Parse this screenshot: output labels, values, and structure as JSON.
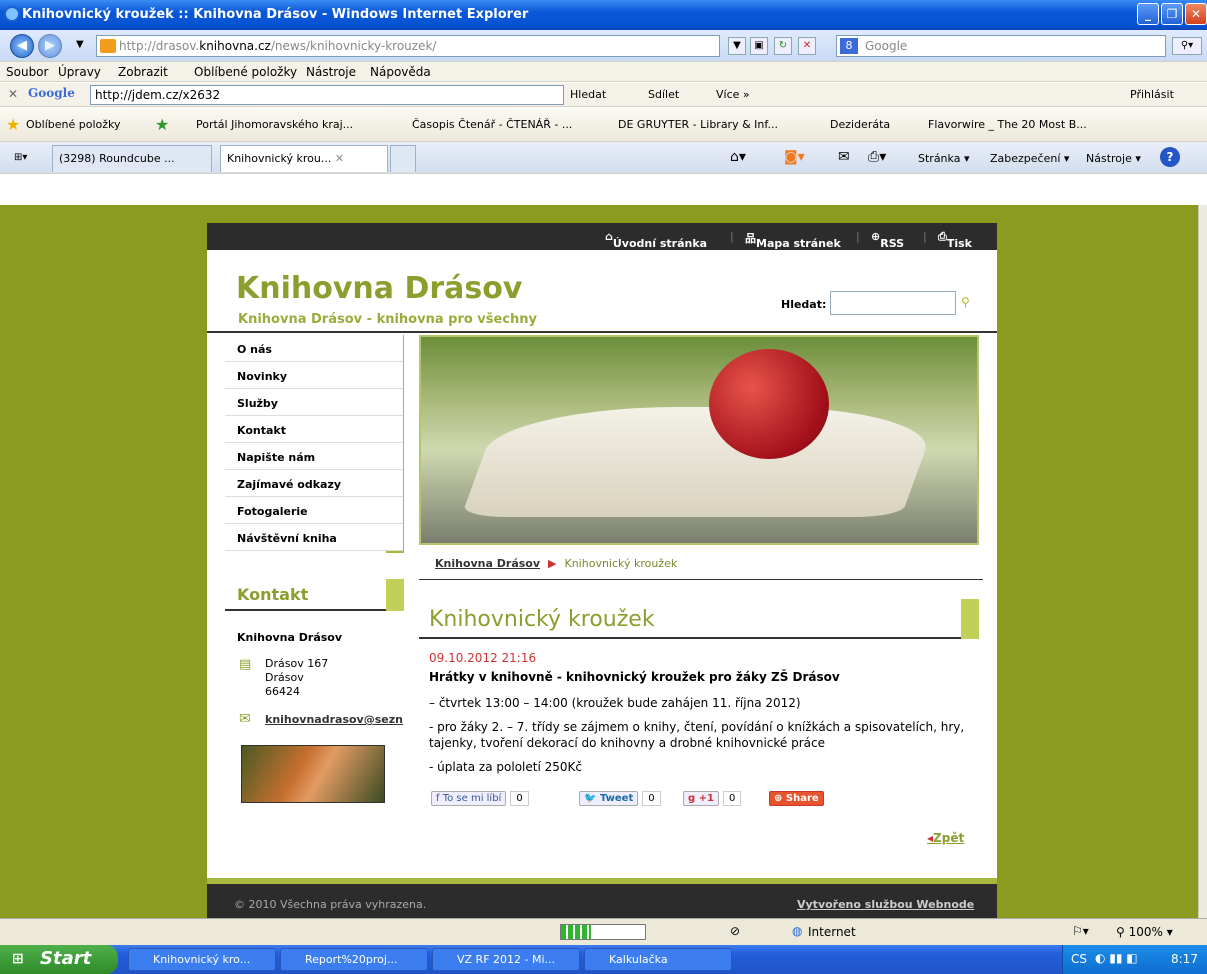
{
  "window": {
    "title": "Knihovnický kroužek :: Knihovna Drásov - Windows Internet Explorer"
  },
  "addressbar": {
    "url_prefix": "http://drasov.",
    "url_domain": "knihovna.cz",
    "url_path": "/news/knihovnicky-krouzek/",
    "search_placeholder": "Google"
  },
  "menubar": [
    "Soubor",
    "Úpravy",
    "Zobrazit",
    "Oblíbené položky",
    "Nástroje",
    "Nápověda"
  ],
  "googlebar": {
    "logo": "Google",
    "input": "http://jdem.cz/x2632",
    "search": "Hledat",
    "share": "Sdílet",
    "more": "Více »",
    "signin": "Přihlásit"
  },
  "favorites": {
    "label": "Oblíbené položky",
    "items": [
      "Portál Jihomoravského kraj...",
      "Časopis Čtenář - ČTENÁŘ - ...",
      "DE GRUYTER - Library & Inf...",
      "Dezideráta",
      "Flavorwire _ The 20 Most B..."
    ]
  },
  "tabs": [
    {
      "label": "(3298) Roundcube ..."
    },
    {
      "label": "Knihovnický krou..."
    }
  ],
  "commandbar": {
    "page": "Stránka",
    "security": "Zabezpečení",
    "tools": "Nástroje"
  },
  "site": {
    "topnav": [
      "Úvodní stránka",
      "Mapa stránek",
      "RSS",
      "Tisk"
    ],
    "logo": "Knihovna Drásov",
    "slogan": "Knihovna Drásov - knihovna pro všechny",
    "search_label": "Hledat:",
    "menu": [
      "O nás",
      "Novinky",
      "Služby",
      "Kontakt",
      "Napište nám",
      "Zajímavé odkazy",
      "Fotogalerie",
      "Návštěvní kniha"
    ],
    "breadcrumb": {
      "home": "Knihovna Drásov",
      "current": "Knihovnický kroužek"
    },
    "contact": {
      "heading": "Kontakt",
      "name": "Knihovna Drásov",
      "address": "Drásov 167\nDrásov\n66424",
      "email": "knihovnadrasov@sezn"
    },
    "article": {
      "heading": "Knihovnický kroužek",
      "date": "09.10.2012 21:16",
      "title": "Hrátky v knihovně - knihovnický kroužek pro žáky ZŠ Drásov",
      "p1": "– čtvrtek 13:00 – 14:00 (kroužek bude zahájen 11. října 2012)",
      "p2": "- pro žáky 2. – 7. třídy se zájmem o knihy, čtení, povídání o knížkách a spisovatelích, hry, tajenky, tvoření dekorací do knihovny a drobné knihovnické práce",
      "p3": "- úplata za pololetí 250Kč",
      "back": "Zpět"
    },
    "social": {
      "like": "To se mi líbí",
      "like_count": "0",
      "tweet": "Tweet",
      "tweet_count": "0",
      "gplus": "+1",
      "gplus_count": "0",
      "share": "Share"
    },
    "footer": {
      "copyright": "© 2010 Všechna práva vyhrazena.",
      "credit": "Vytvořeno službou Webnode"
    }
  },
  "status": {
    "zone": "Internet",
    "zoom": "100%"
  },
  "taskbar": {
    "start": "Start",
    "tasks": [
      "Knihovnický kro...",
      "Report%20proj...",
      "VZ RF 2012 - Mi...",
      "Kalkulačka"
    ],
    "lang": "CS",
    "time": "8:17"
  }
}
